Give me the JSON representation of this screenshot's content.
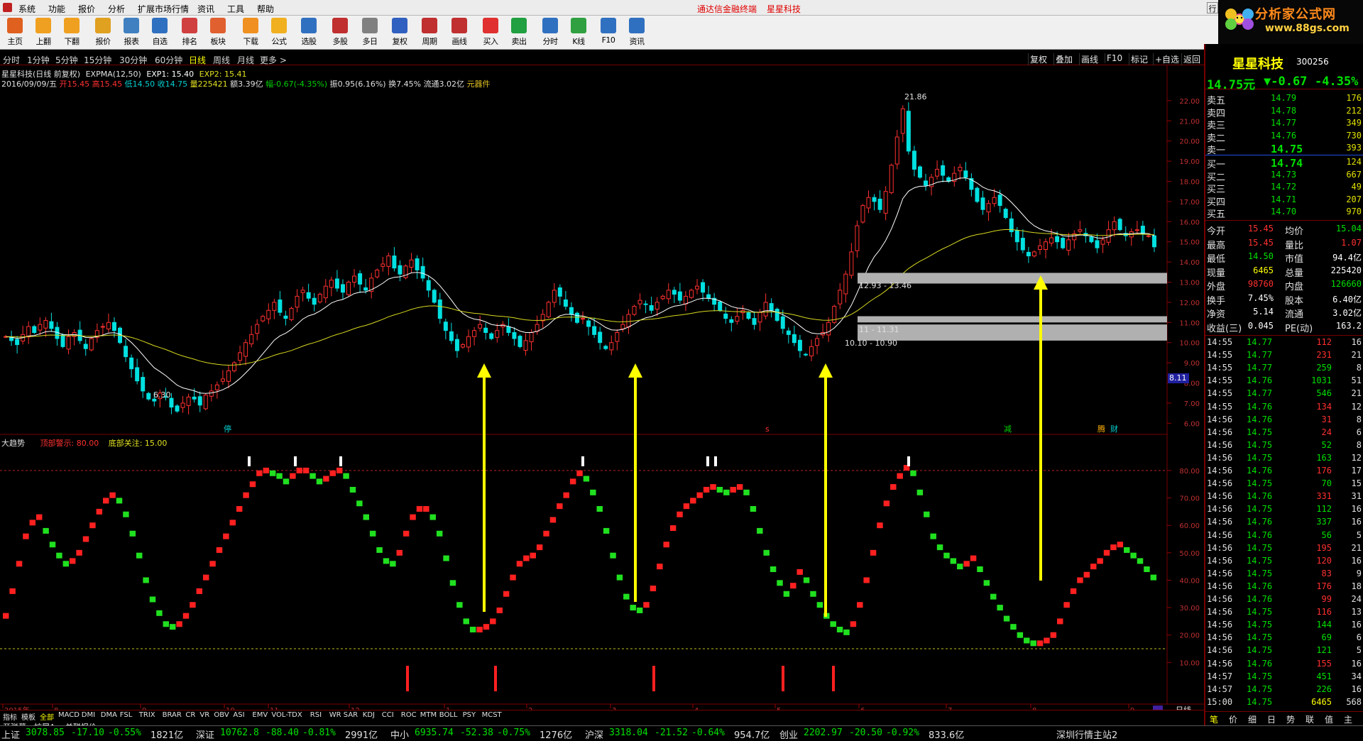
{
  "menubar": {
    "items": [
      "系统",
      "功能",
      "报价",
      "分析",
      "扩展市场行情",
      "资讯",
      "工具",
      "帮助"
    ],
    "center_left": "通达信金融终端",
    "center_right": "星星科技",
    "right_btn": "行"
  },
  "toolbar": {
    "buttons": [
      {
        "label": "主页",
        "icon": "home-icon",
        "color": "#e06020"
      },
      {
        "label": "上翻",
        "icon": "up-arrow-icon",
        "color": "#f0a020"
      },
      {
        "label": "下翻",
        "icon": "down-arrow-icon",
        "color": "#f0a020"
      },
      {
        "label": "报价",
        "icon": "yen-icon",
        "color": "#e0a020"
      },
      {
        "label": "报表",
        "icon": "table-icon",
        "color": "#4080c0"
      },
      {
        "label": "自选",
        "icon": "f6-icon",
        "color": "#3070c0"
      },
      {
        "label": "排名",
        "icon": "ranking-icon",
        "color": "#d04040"
      },
      {
        "label": "板块",
        "icon": "blocks-icon",
        "color": "#e06030"
      },
      {
        "label": "下载",
        "icon": "download-icon",
        "color": "#f09020"
      },
      {
        "label": "公式",
        "icon": "formula-icon",
        "color": "#f0b020"
      },
      {
        "label": "选股",
        "icon": "stock-pick-icon",
        "color": "#3070c0"
      },
      {
        "label": "多股",
        "icon": "multi-stock-icon",
        "color": "#c03030"
      },
      {
        "label": "多日",
        "icon": "clock-icon",
        "color": "#808080"
      },
      {
        "label": "复权",
        "icon": "restore-icon",
        "color": "#3060c0"
      },
      {
        "label": "周期",
        "icon": "f8-icon",
        "color": "#c03030"
      },
      {
        "label": "画线",
        "icon": "draw-line-icon",
        "color": "#c03030"
      },
      {
        "label": "买入",
        "icon": "buy-icon",
        "color": "#e03030"
      },
      {
        "label": "卖出",
        "icon": "sell-icon",
        "color": "#20a040"
      },
      {
        "label": "分时",
        "icon": "intraday-icon",
        "color": "#3070c0"
      },
      {
        "label": "K线",
        "icon": "kline-icon",
        "color": "#30a040"
      },
      {
        "label": "F10",
        "icon": "f10-icon",
        "color": "#3070c0"
      },
      {
        "label": "资讯",
        "icon": "news-icon",
        "color": "#3070c0"
      }
    ]
  },
  "logo": {
    "text": "分析家公式网",
    "url": "www.88gs.com"
  },
  "periods": {
    "items": [
      "分时",
      "1分钟",
      "5分钟",
      "15分钟",
      "30分钟",
      "60分钟",
      "日线",
      "周线",
      "月线",
      "更多 >"
    ],
    "active": "日线"
  },
  "right_tools": [
    "复权",
    "叠加",
    "画线",
    "F10",
    "标记",
    "+自选",
    "返回"
  ],
  "info": {
    "line1_name": "星星科技(日线 前复权)",
    "line1_expma": "EXPMA(12,50)",
    "line1_exp1": "EXP1: 15.40",
    "line1_exp2": "EXP2: 15.41",
    "line2_date": "2016/09/09/五",
    "line2_open": "开15.45",
    "line2_high": "高15.45",
    "line2_low": "低14.50",
    "line2_close": "收14.75",
    "line2_vol": "量225421",
    "line2_amt": "额3.39亿",
    "line2_chg": "幅-0.67(-4.35%)",
    "line2_amp": "振0.95(6.16%)",
    "line2_turn": "换7.45%",
    "line2_float": "流通3.02亿",
    "line2_sector": "元器件"
  },
  "chart_data": [
    {
      "type": "candlestick",
      "title": "星星科技(日线 前复权)",
      "xlabel": "",
      "ylabel": "",
      "x_ticks": [
        "2015年",
        "8",
        "9",
        "10",
        "11",
        "12",
        "1",
        "2",
        "3",
        "4",
        "5",
        "6",
        "7",
        "8",
        "9"
      ],
      "y_ticks": [
        "6.00",
        "7.00",
        "8.00",
        "9.00",
        "10.00",
        "11.00",
        "12.00",
        "13.00",
        "14.00",
        "15.00",
        "16.00",
        "17.00",
        "18.00",
        "19.00",
        "20.00",
        "21.00",
        "22.00"
      ],
      "ylim": [
        5.8,
        22.7
      ],
      "closes": [
        10.3,
        10.1,
        9.9,
        10.4,
        10.8,
        10.5,
        10.9,
        11.1,
        10.7,
        10.2,
        9.8,
        10.3,
        10.5,
        10.1,
        9.7,
        10.2,
        10.6,
        10.8,
        11.0,
        10.6,
        10.0,
        9.3,
        8.7,
        8.1,
        7.6,
        7.2,
        7.1,
        7.5,
        7.3,
        6.8,
        6.6,
        7.0,
        7.3,
        7.2,
        6.9,
        7.4,
        7.6,
        7.9,
        8.2,
        8.6,
        9.0,
        9.5,
        10.0,
        10.4,
        10.9,
        11.3,
        11.6,
        12.0,
        11.5,
        11.2,
        11.7,
        12.3,
        12.6,
        12.2,
        11.9,
        12.4,
        12.8,
        13.1,
        12.7,
        12.5,
        13.0,
        13.3,
        12.9,
        12.6,
        13.2,
        13.6,
        13.9,
        14.3,
        13.7,
        13.4,
        13.8,
        14.1,
        13.6,
        13.2,
        12.6,
        12.0,
        11.2,
        10.6,
        10.1,
        9.6,
        9.9,
        10.3,
        10.6,
        10.9,
        10.5,
        10.2,
        10.6,
        10.9,
        10.5,
        10.2,
        9.8,
        10.1,
        10.5,
        10.9,
        11.4,
        12.0,
        12.6,
        12.3,
        11.8,
        11.4,
        11.0,
        11.2,
        10.8,
        10.4,
        10.0,
        9.7,
        10.0,
        10.5,
        10.9,
        11.4,
        11.8,
        12.1,
        11.9,
        11.6,
        12.0,
        12.3,
        12.6,
        12.4,
        12.1,
        12.3,
        12.6,
        12.8,
        12.5,
        12.2,
        11.9,
        11.6,
        11.2,
        11.0,
        11.3,
        11.6,
        11.2,
        10.9,
        11.5,
        12.0,
        11.6,
        11.1,
        10.7,
        10.4,
        10.0,
        9.6,
        9.4,
        9.8,
        10.2,
        10.5,
        11.0,
        11.8,
        12.6,
        13.4,
        14.5,
        15.8,
        16.8,
        17.2,
        17.0,
        16.6,
        17.5,
        18.8,
        20.2,
        21.6,
        19.5,
        18.6,
        18.2,
        17.8,
        18.2,
        18.6,
        18.3,
        18.0,
        18.4,
        18.7,
        18.2,
        17.6,
        17.0,
        16.6,
        16.9,
        17.2,
        16.8,
        16.2,
        15.5,
        15.0,
        14.6,
        14.3,
        14.5,
        14.8,
        15.0,
        15.2,
        15.0,
        14.7,
        15.1,
        15.4,
        15.6,
        15.3,
        15.0,
        14.7,
        15.1,
        15.6,
        16.0,
        15.6,
        15.3,
        15.5,
        15.6,
        15.4,
        15.3,
        14.75
      ],
      "series": [
        {
          "name": "EXP1",
          "color": "#ffffff"
        },
        {
          "name": "EXP2",
          "color": "#d8d820"
        }
      ],
      "annotations": [
        "21.86",
        "6.30",
        "12.93 - 13.46",
        "11 - 11.31",
        "10.10 - 10.90",
        "8.11"
      ],
      "markers": [
        "停",
        "s",
        "减",
        "腾",
        "财"
      ]
    },
    {
      "type": "bar",
      "title": "大趋势",
      "legend": [
        "顶部警示: 80.00",
        "底部关注: 15.00"
      ],
      "y_ticks": [
        "10.00",
        "20.00",
        "30.00",
        "40.00",
        "50.00",
        "60.00",
        "70.00",
        "80.00"
      ],
      "ylim": [
        0,
        88
      ],
      "values": [
        27,
        36,
        46,
        56,
        61,
        63,
        58,
        53,
        49,
        46,
        47,
        50,
        55,
        60,
        65,
        69,
        71,
        69,
        64,
        57,
        49,
        40,
        33,
        28,
        24,
        23,
        24,
        27,
        31,
        36,
        41,
        46,
        51,
        56,
        61,
        66,
        71,
        75,
        79,
        80,
        79,
        78,
        76,
        78,
        80,
        80,
        78,
        76,
        77,
        79,
        80,
        78,
        73,
        68,
        63,
        57,
        51,
        47,
        46,
        50,
        57,
        63,
        66,
        66,
        63,
        57,
        48,
        39,
        31,
        25,
        22,
        22,
        23,
        25,
        29,
        35,
        41,
        46,
        48,
        49,
        52,
        57,
        62,
        67,
        71,
        76,
        79,
        77,
        72,
        66,
        58,
        49,
        41,
        34,
        30,
        29,
        31,
        37,
        45,
        53,
        59,
        64,
        67,
        69,
        71,
        73,
        74,
        73,
        72,
        73,
        74,
        72,
        66,
        58,
        50,
        44,
        39,
        35,
        38,
        43,
        40,
        35,
        31,
        27,
        24,
        22,
        21,
        24,
        31,
        40,
        50,
        60,
        68,
        74,
        78,
        81,
        79,
        72,
        64,
        56,
        52,
        49,
        47,
        45,
        46,
        48,
        44,
        39,
        34,
        30,
        26,
        23,
        20,
        18,
        17,
        17,
        18,
        20,
        25,
        31,
        36,
        40,
        42,
        45,
        47,
        50,
        52,
        53,
        51,
        49,
        47,
        44,
        41
      ],
      "signals_top": [
        true,
        true,
        true,
        true,
        true,
        true
      ],
      "signals_bottom": [
        true,
        true,
        true,
        true,
        true
      ]
    }
  ],
  "quote": {
    "name": "星星科技",
    "code": "300256",
    "price": "14.75元",
    "change": "▼-0.67",
    "pct": "-4.35%",
    "asks": [
      {
        "label": "卖五",
        "price": "14.79",
        "vol": "176"
      },
      {
        "label": "卖四",
        "price": "14.78",
        "vol": "212"
      },
      {
        "label": "卖三",
        "price": "14.77",
        "vol": "349"
      },
      {
        "label": "卖二",
        "price": "14.76",
        "vol": "730"
      },
      {
        "label": "卖一",
        "price": "14.75",
        "vol": "393"
      }
    ],
    "bids": [
      {
        "label": "买一",
        "price": "14.74",
        "vol": "124"
      },
      {
        "label": "买二",
        "price": "14.73",
        "vol": "667"
      },
      {
        "label": "买三",
        "price": "14.72",
        "vol": "49"
      },
      {
        "label": "买四",
        "price": "14.71",
        "vol": "207"
      },
      {
        "label": "买五",
        "price": "14.70",
        "vol": "970"
      }
    ],
    "stats": [
      {
        "l1": "今开",
        "v1": "15.45",
        "c1": "red",
        "l2": "均价",
        "v2": "15.04",
        "c2": "grn"
      },
      {
        "l1": "最高",
        "v1": "15.45",
        "c1": "red",
        "l2": "量比",
        "v2": "1.07",
        "c2": "red"
      },
      {
        "l1": "最低",
        "v1": "14.50",
        "c1": "grn",
        "l2": "市值",
        "v2": "94.4亿",
        "c2": "wht"
      },
      {
        "l1": "现量",
        "v1": "6465",
        "c1": "yel",
        "l2": "总量",
        "v2": "225420",
        "c2": "wht"
      },
      {
        "l1": "外盘",
        "v1": "98760",
        "c1": "red",
        "l2": "内盘",
        "v2": "126660",
        "c2": "grn"
      },
      {
        "l1": "换手",
        "v1": "7.45%",
        "c1": "wht",
        "l2": "股本",
        "v2": "6.40亿",
        "c2": "wht"
      },
      {
        "l1": "净资",
        "v1": "5.14",
        "c1": "wht",
        "l2": "流通",
        "v2": "3.02亿",
        "c2": "wht"
      },
      {
        "l1": "收益(三)",
        "v1": "0.045",
        "c1": "wht",
        "l2": "PE(动)",
        "v2": "163.2",
        "c2": "wht"
      }
    ],
    "ticks": [
      {
        "t": "14:55",
        "p": "14.77",
        "v": "112",
        "n": "16",
        "c": "red"
      },
      {
        "t": "14:55",
        "p": "14.77",
        "v": "231",
        "n": "21",
        "c": "red"
      },
      {
        "t": "14:55",
        "p": "14.77",
        "v": "259",
        "n": "8",
        "c": "grn"
      },
      {
        "t": "14:55",
        "p": "14.76",
        "v": "1031",
        "n": "51",
        "c": "grn"
      },
      {
        "t": "14:55",
        "p": "14.77",
        "v": "546",
        "n": "21",
        "c": "grn"
      },
      {
        "t": "14:55",
        "p": "14.76",
        "v": "134",
        "n": "12",
        "c": "red"
      },
      {
        "t": "14:56",
        "p": "14.76",
        "v": "31",
        "n": "8",
        "c": "red"
      },
      {
        "t": "14:56",
        "p": "14.75",
        "v": "24",
        "n": "6",
        "c": "red"
      },
      {
        "t": "14:56",
        "p": "14.75",
        "v": "52",
        "n": "8",
        "c": "grn"
      },
      {
        "t": "14:56",
        "p": "14.75",
        "v": "163",
        "n": "12",
        "c": "grn"
      },
      {
        "t": "14:56",
        "p": "14.76",
        "v": "176",
        "n": "17",
        "c": "red"
      },
      {
        "t": "14:56",
        "p": "14.75",
        "v": "70",
        "n": "15",
        "c": "grn"
      },
      {
        "t": "14:56",
        "p": "14.76",
        "v": "331",
        "n": "31",
        "c": "red"
      },
      {
        "t": "14:56",
        "p": "14.75",
        "v": "112",
        "n": "16",
        "c": "grn"
      },
      {
        "t": "14:56",
        "p": "14.76",
        "v": "337",
        "n": "16",
        "c": "grn"
      },
      {
        "t": "14:56",
        "p": "14.76",
        "v": "56",
        "n": "5",
        "c": "grn"
      },
      {
        "t": "14:56",
        "p": "14.75",
        "v": "195",
        "n": "21",
        "c": "red"
      },
      {
        "t": "14:56",
        "p": "14.75",
        "v": "120",
        "n": "16",
        "c": "red"
      },
      {
        "t": "14:56",
        "p": "14.75",
        "v": "83",
        "n": "9",
        "c": "red"
      },
      {
        "t": "14:56",
        "p": "14.76",
        "v": "176",
        "n": "18",
        "c": "red"
      },
      {
        "t": "14:56",
        "p": "14.76",
        "v": "99",
        "n": "24",
        "c": "red"
      },
      {
        "t": "14:56",
        "p": "14.75",
        "v": "116",
        "n": "13",
        "c": "red"
      },
      {
        "t": "14:56",
        "p": "14.75",
        "v": "144",
        "n": "16",
        "c": "grn"
      },
      {
        "t": "14:56",
        "p": "14.75",
        "v": "69",
        "n": "6",
        "c": "grn"
      },
      {
        "t": "14:56",
        "p": "14.75",
        "v": "121",
        "n": "5",
        "c": "grn"
      },
      {
        "t": "14:56",
        "p": "14.76",
        "v": "155",
        "n": "16",
        "c": "red"
      },
      {
        "t": "14:57",
        "p": "14.75",
        "v": "451",
        "n": "34",
        "c": "grn"
      },
      {
        "t": "14:57",
        "p": "14.75",
        "v": "226",
        "n": "16",
        "c": "grn"
      },
      {
        "t": "15:00",
        "p": "14.75",
        "v": "6465",
        "n": "568",
        "c": "yel"
      }
    ],
    "tabs": [
      "笔",
      "价",
      "细",
      "日",
      "势",
      "联",
      "值",
      "主"
    ]
  },
  "indicator_tabs": [
    "指标",
    "模板",
    "全部",
    "MACD",
    "DMI",
    "DMA",
    "FSL",
    "TRIX",
    "BRAR",
    "CR",
    "VR",
    "OBV",
    "ASI",
    "EMV",
    "VOL-TDX",
    "RSI",
    "WR",
    "SAR",
    "KDJ",
    "CCI",
    "ROC",
    "MTM",
    "BOLL",
    "PSY",
    "MCST"
  ],
  "bottom_links": [
    "开弹幕",
    "扩展A",
    "关联报价"
  ],
  "period_label": "日线",
  "status": [
    {
      "name": "上证",
      "val": "3078.85",
      "chg": "-17.10",
      "pct": "-0.55%",
      "amt": "1821亿"
    },
    {
      "name": "深证",
      "val": "10762.8",
      "chg": "-88.40",
      "pct": "-0.81%",
      "amt": "2991亿"
    },
    {
      "name": "中小",
      "val": "6935.74",
      "chg": "-52.38",
      "pct": "-0.75%",
      "amt": "1276亿"
    },
    {
      "name": "沪深",
      "val": "3318.04",
      "chg": "-21.52",
      "pct": "-0.64%",
      "amt": "954.7亿"
    },
    {
      "name": "创业",
      "val": "2202.97",
      "chg": "-20.50",
      "pct": "-0.92%",
      "amt": "833.6亿"
    }
  ],
  "server": "深圳行情主站2",
  "colors": {
    "up": "#ff3030",
    "down": "#00e0e0",
    "ind_up": "#ff2020",
    "ind_down": "#20e020",
    "arrow": "#ffff00",
    "box": "#b0b0b0"
  }
}
